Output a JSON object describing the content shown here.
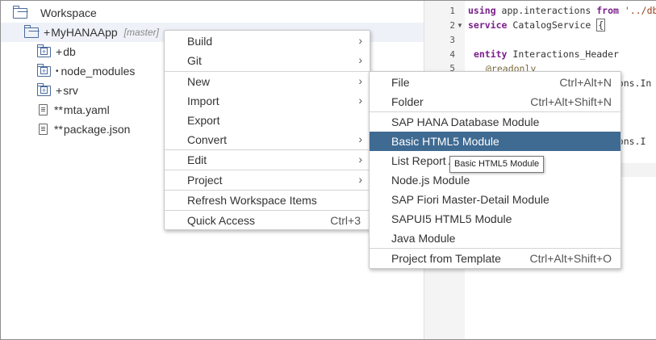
{
  "workspace": {
    "root_label": "Workspace",
    "project": {
      "prefix": "+",
      "name": "MyHANAApp",
      "branch": "[master]"
    },
    "children": [
      {
        "prefix": "+",
        "name": "db",
        "icon": "folder-icon"
      },
      {
        "prefix": "•",
        "name": "node_modules",
        "icon": "folder-icon"
      },
      {
        "prefix": "+",
        "name": "srv",
        "icon": "folder-icon"
      },
      {
        "prefix": "**",
        "name": "mta.yaml",
        "icon": "file-icon"
      },
      {
        "prefix": "**",
        "name": "package.json",
        "icon": "file-icon"
      }
    ]
  },
  "context_menu": {
    "items": [
      {
        "label": "Build",
        "has_submenu": true
      },
      {
        "label": "Git",
        "has_submenu": true
      },
      {
        "label": "New",
        "has_submenu": true
      },
      {
        "label": "Import",
        "has_submenu": true
      },
      {
        "label": "Export",
        "has_submenu": false
      },
      {
        "label": "Convert",
        "has_submenu": true
      },
      {
        "label": "Edit",
        "has_submenu": true
      },
      {
        "label": "Project",
        "has_submenu": true
      },
      {
        "label": "Refresh Workspace Items",
        "has_submenu": false
      },
      {
        "label": "Quick Access",
        "shortcut": "Ctrl+3"
      }
    ]
  },
  "new_submenu": {
    "items": [
      {
        "label": "File",
        "shortcut": "Ctrl+Alt+N"
      },
      {
        "label": "Folder",
        "shortcut": "Ctrl+Alt+Shift+N"
      },
      {
        "label": "SAP HANA Database Module"
      },
      {
        "label": "Basic HTML5 Module",
        "highlighted": true
      },
      {
        "label": "List Report Applicati"
      },
      {
        "label": "Node.js Module"
      },
      {
        "label": "SAP Fiori Master-Detail Module"
      },
      {
        "label": "SAPUI5 HTML5 Module"
      },
      {
        "label": "Java Module"
      },
      {
        "label": "Project from Template",
        "shortcut": "Ctrl+Alt+Shift+O"
      }
    ]
  },
  "tooltip": {
    "text": "Basic HTML5 Module"
  },
  "editor": {
    "line_numbers": [
      "1",
      "2",
      "3",
      "4",
      "5"
    ],
    "lines": {
      "l1_kw": "using",
      "l1_mid": " app.interactions ",
      "l1_kw2": "from",
      "l1_str": " '../db/i",
      "l2_kw": "service",
      "l2_mid": " CatalogService ",
      "l2_brace": "{",
      "l4_kw": "entity",
      "l4_mid": " Interactions_Header",
      "l5_ann": "@readonly",
      "frag1": "ctions.In",
      "frag2": "ctions.I"
    }
  },
  "colors": {
    "highlight": "#3f6a92",
    "keyword": "#7a1f8a",
    "icon": "#4a6a9a"
  }
}
